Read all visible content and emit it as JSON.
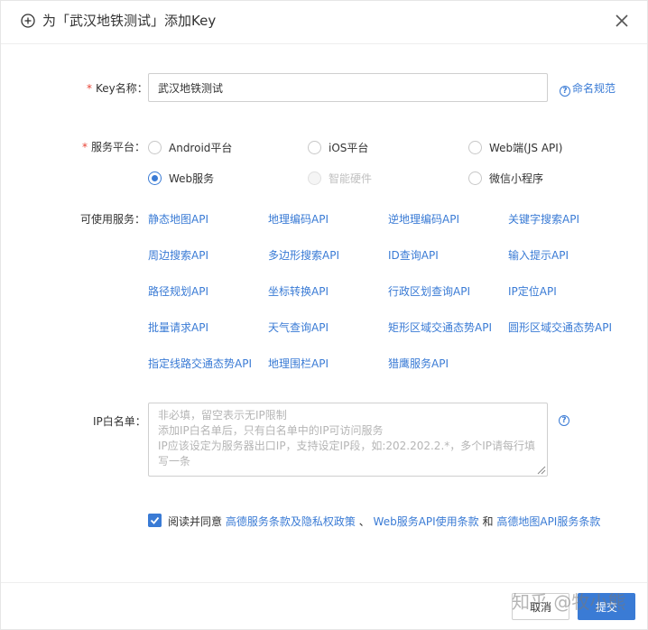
{
  "dialog": {
    "title": "为「武汉地铁测试」添加Key",
    "close_icon": "close-icon",
    "plus_icon": "plus-circle-icon"
  },
  "key_name": {
    "required_mark": "*",
    "label": "Key名称",
    "value": "武汉地铁测试",
    "help_link": "命名规范"
  },
  "platform": {
    "required_mark": "*",
    "label": "服务平台",
    "options": [
      {
        "label": "Android平台",
        "checked": false,
        "disabled": false
      },
      {
        "label": "iOS平台",
        "checked": false,
        "disabled": false
      },
      {
        "label": "Web端(JS API)",
        "checked": false,
        "disabled": false
      },
      {
        "label": "Web服务",
        "checked": true,
        "disabled": false
      },
      {
        "label": "智能硬件",
        "checked": false,
        "disabled": true
      },
      {
        "label": "微信小程序",
        "checked": false,
        "disabled": false
      }
    ]
  },
  "services": {
    "label": "可使用服务",
    "items": [
      "静态地图API",
      "地理编码API",
      "逆地理编码API",
      "关键字搜索API",
      "周边搜索API",
      "多边形搜索API",
      "ID查询API",
      "输入提示API",
      "路径规划API",
      "坐标转换API",
      "行政区划查询API",
      "IP定位API",
      "批量请求API",
      "天气查询API",
      "矩形区域交通态势API",
      "圆形区域交通态势API",
      "指定线路交通态势API",
      "地理围栏API",
      "猎鹰服务API"
    ]
  },
  "ip_whitelist": {
    "label": "IP白名单",
    "placeholder_lines": [
      "非必填，留空表示无IP限制",
      "添加IP白名单后，只有白名单中的IP可访问服务",
      "IP应该设定为服务器出口IP，支持设定IP段，如:202.202.2.*，多个IP请每行填",
      "写一条"
    ]
  },
  "agreement": {
    "checked": true,
    "prefix": "阅读并同意",
    "link1": "高德服务条款及隐私权政策",
    "sep": "、",
    "link2": "Web服务API使用条款",
    "and": "和",
    "link3": "高德地图API服务条款"
  },
  "footer": {
    "cancel_label": "取消",
    "submit_label": "提交"
  },
  "watermark": "知乎 @牧小熊",
  "colors": {
    "accent": "#3a7bd5",
    "required": "#e84335"
  }
}
